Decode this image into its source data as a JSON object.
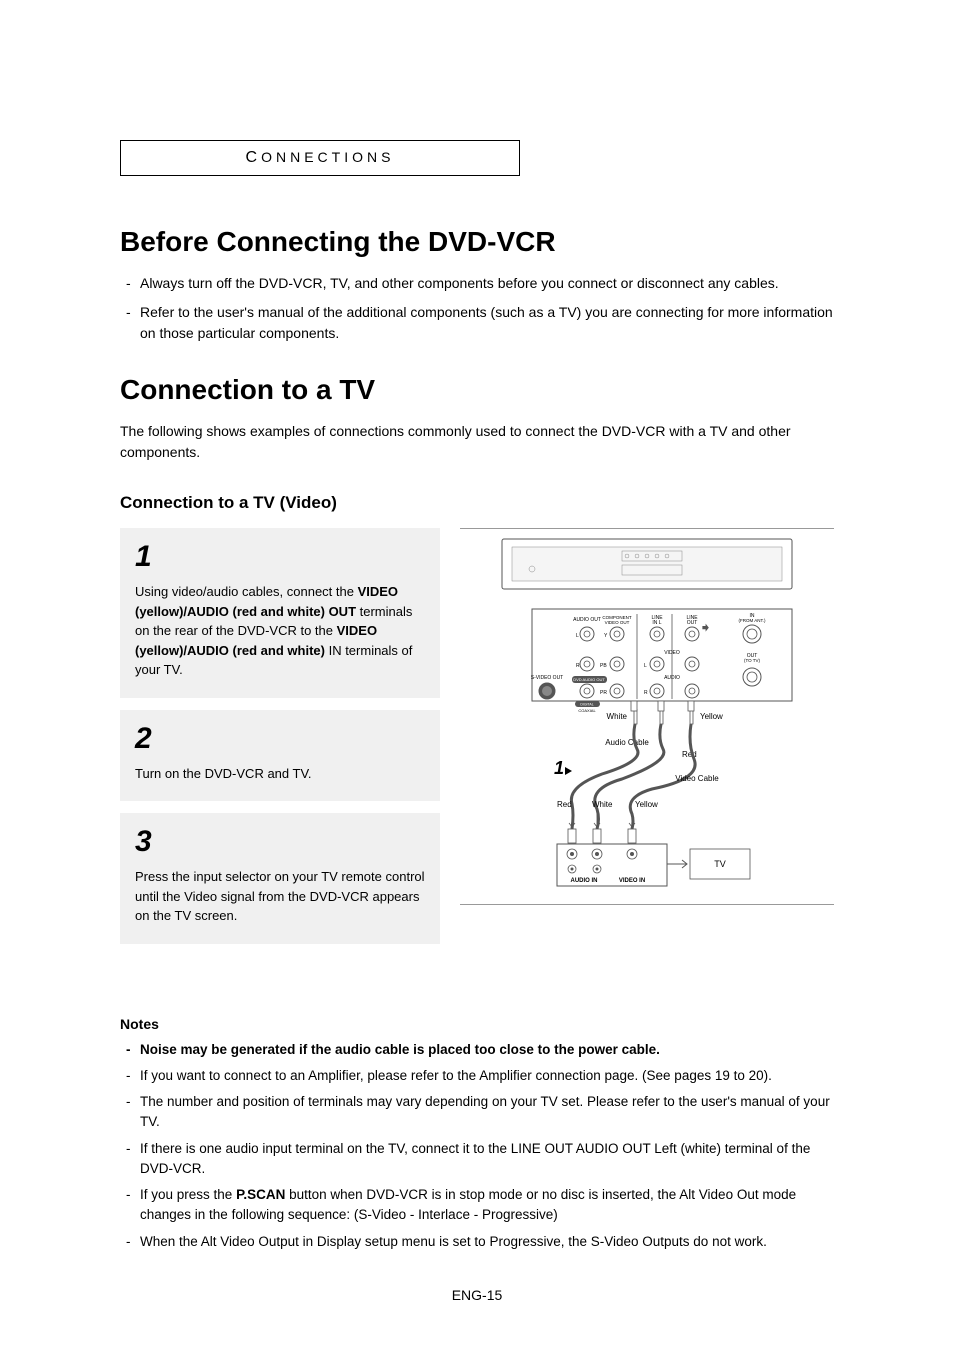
{
  "header_tab": "CONNECTIONS",
  "heading1": "Before Connecting the DVD-VCR",
  "bullets1": [
    "Always turn off the DVD-VCR, TV, and other components before you connect or disconnect any cables.",
    "Refer to the user's manual of the additional components (such as a TV) you are connecting for more information on those particular components."
  ],
  "heading2": "Connection to a TV",
  "intro2": "The following shows examples of connections commonly used to connect the DVD-VCR with a TV and other components.",
  "subheading": "Connection to a TV (Video)",
  "steps": [
    {
      "num": "1",
      "text_parts": [
        {
          "t": "Using video/audio cables, connect the ",
          "b": false
        },
        {
          "t": "VIDEO (yellow)/AUDIO (red and white) OUT",
          "b": true
        },
        {
          "t": " terminals on the rear of the DVD-VCR to the ",
          "b": false
        },
        {
          "t": "VIDEO (yellow)/AUDIO (red and white)",
          "b": true
        },
        {
          "t": " IN terminals of your TV.",
          "b": false
        }
      ]
    },
    {
      "num": "2",
      "text_parts": [
        {
          "t": "Turn on the DVD-VCR and TV.",
          "b": false
        }
      ]
    },
    {
      "num": "3",
      "text_parts": [
        {
          "t": "Press the input selector on your TV remote control until the Video signal from the DVD-VCR appears on the TV screen.",
          "b": false
        }
      ]
    }
  ],
  "diagram": {
    "labels": {
      "white": "White",
      "yellow": "Yellow",
      "red": "Red",
      "audio_cable": "Audio Cable",
      "video_cable": "Video Cable",
      "tv": "TV",
      "audio_in": "AUDIO IN",
      "video_in": "VIDEO IN",
      "step_marker": "1",
      "s_video_out": "S-VIDEO OUT",
      "audio_out": "AUDIO OUT",
      "component_video_out": "COMPONENT VIDEO OUT",
      "line_in_l": "LINE IN L",
      "line_out": "LINE OUT",
      "in_from_ant": "IN (FROM ANT.)",
      "out_to_tv": "OUT (TO TV)",
      "video": "VIDEO",
      "dvd_audio_out": "DVD AUDIO OUT",
      "audio": "AUDIO",
      "digital": "DIGITAL",
      "coaxial": "COAXIAL",
      "l": "L",
      "r": "R",
      "y": "Y",
      "pr": "PR",
      "pb": "PB"
    }
  },
  "notes_heading": "Notes",
  "notes": [
    {
      "text": "Noise may be generated if the audio cable is placed too close to the power cable.",
      "bold": true
    },
    {
      "text": "If you want to connect to an Amplifier, please refer to the Amplifier connection page. (See pages 19 to 20).",
      "bold": false
    },
    {
      "text": "The number and position of terminals may vary depending on your TV set. Please refer to the user's manual of your TV.",
      "bold": false
    },
    {
      "text": "If there is one audio input terminal on the TV, connect it to the LINE OUT AUDIO OUT Left (white) terminal of the DVD-VCR.",
      "bold": false
    },
    {
      "text_parts": [
        {
          "t": "If you press the ",
          "b": false
        },
        {
          "t": "P.SCAN",
          "b": true
        },
        {
          "t": " button when DVD-VCR is in stop mode or no disc is inserted, the Alt Video Out mode changes in the following sequence: (S-Video - Interlace - Progressive)",
          "b": false
        }
      ]
    },
    {
      "text": "When the Alt Video Output in Display setup menu is set to Progressive, the S-Video Outputs do not work.",
      "bold": false
    }
  ],
  "page_num": "ENG-15"
}
